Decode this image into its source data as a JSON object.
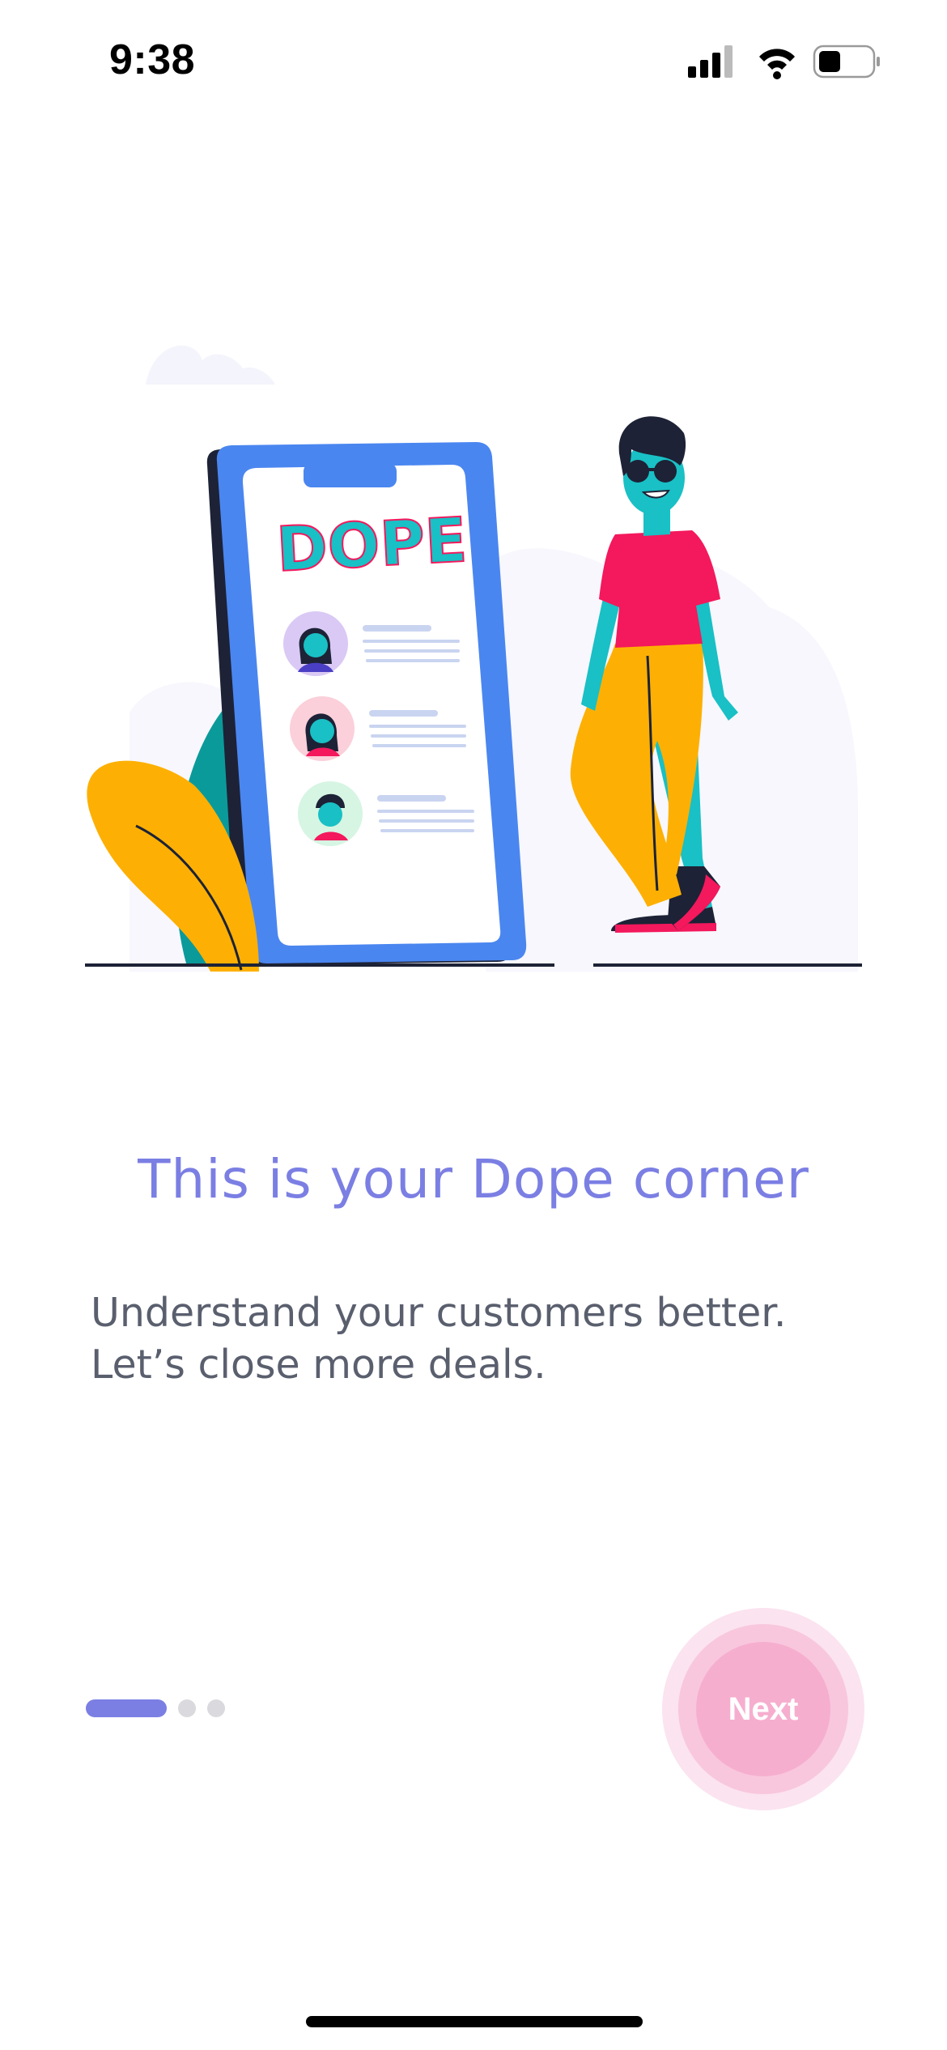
{
  "status_bar": {
    "time": "9:38",
    "icons": [
      "cellular-signal-icon",
      "wifi-icon",
      "battery-icon"
    ]
  },
  "illustration": {
    "phone_brand_text": "DOPE"
  },
  "onboarding": {
    "title": "This is your Dope corner",
    "subtitle_lines": [
      "Understand your customers better.",
      "Let’s close more deals."
    ],
    "page_indicator": {
      "current": 1,
      "total": 3
    },
    "next_label": "Next"
  },
  "colors": {
    "accent": "#7b7fe3",
    "next_button": "#f6aecf",
    "body_text": "#5a5f6e",
    "phone_blue": "#4a86f0",
    "person_skin": "#19c0c5",
    "shirt": "#f4185c",
    "pants": "#fdb003"
  }
}
